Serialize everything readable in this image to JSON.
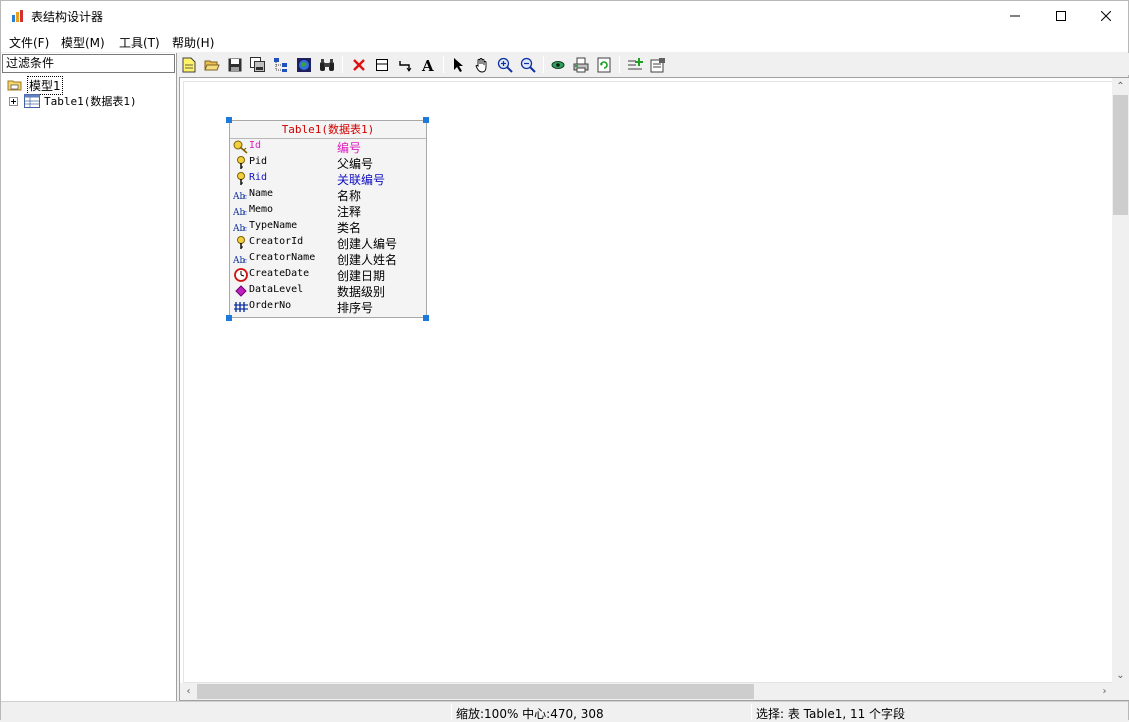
{
  "window": {
    "title": "表结构设计器"
  },
  "menu": [
    {
      "label": "文件(F)"
    },
    {
      "label": "模型(M)"
    },
    {
      "label": "工具(T)"
    },
    {
      "label": "帮助(H)"
    }
  ],
  "left_panel": {
    "filter_value": "过滤条件",
    "tree": {
      "root_label": "模型1",
      "child_label": "Table1(数据表1)"
    }
  },
  "toolbar": {
    "buttons": [
      {
        "icon": "new-file-icon"
      },
      {
        "icon": "open-folder-icon"
      },
      {
        "icon": "save-icon"
      },
      {
        "icon": "save-all-icon"
      },
      {
        "icon": "tree-layout-icon"
      },
      {
        "icon": "globe-icon"
      },
      {
        "icon": "binoculars-icon"
      },
      {
        "icon": "delete-icon"
      },
      {
        "icon": "table-icon"
      },
      {
        "icon": "relation-icon"
      },
      {
        "icon": "text-icon"
      },
      {
        "icon": "pointer-icon"
      },
      {
        "icon": "hand-icon"
      },
      {
        "icon": "zoom-in-icon"
      },
      {
        "icon": "zoom-out-icon"
      },
      {
        "icon": "view-icon"
      },
      {
        "icon": "print-icon"
      },
      {
        "icon": "refresh-icon"
      },
      {
        "icon": "add-field-icon"
      },
      {
        "icon": "properties-icon"
      }
    ]
  },
  "entity": {
    "title": "Table1(数据表1)",
    "fields": [
      {
        "name": "Id",
        "caption": "编号",
        "icon": "primary-key-icon",
        "color": "#e020c0"
      },
      {
        "name": "Pid",
        "caption": "父编号",
        "icon": "foreign-key-icon",
        "color": "#000000"
      },
      {
        "name": "Rid",
        "caption": "关联编号",
        "icon": "foreign-key-icon",
        "color": "#1010c0"
      },
      {
        "name": "Name",
        "caption": "名称",
        "icon": "string-type-icon",
        "color": "#000000"
      },
      {
        "name": "Memo",
        "caption": "注释",
        "icon": "string-type-icon",
        "color": "#000000"
      },
      {
        "name": "TypeName",
        "caption": "类名",
        "icon": "string-type-icon",
        "color": "#000000"
      },
      {
        "name": "CreatorId",
        "caption": "创建人编号",
        "icon": "foreign-key-icon",
        "color": "#000000"
      },
      {
        "name": "CreatorName",
        "caption": "创建人姓名",
        "icon": "string-type-icon",
        "color": "#000000"
      },
      {
        "name": "CreateDate",
        "caption": "创建日期",
        "icon": "datetime-type-icon",
        "color": "#000000"
      },
      {
        "name": "DataLevel",
        "caption": "数据级别",
        "icon": "enum-type-icon",
        "color": "#000000"
      },
      {
        "name": "OrderNo",
        "caption": "排序号",
        "icon": "number-type-icon",
        "color": "#000000"
      }
    ]
  },
  "statusbar": {
    "zoom": "缩放:100% 中心:470, 308",
    "selection": "选择: 表 Table1, 11 个字段"
  }
}
